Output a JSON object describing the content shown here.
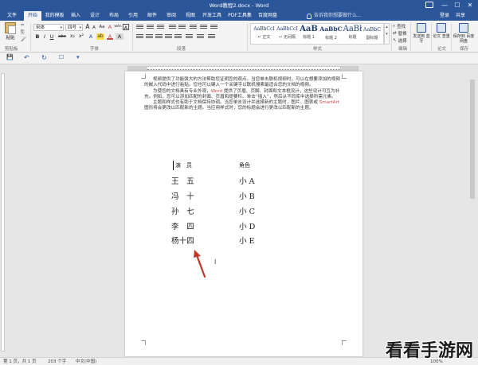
{
  "app": {
    "title": "Word教程2.docx - Word",
    "window_buttons": [
      "—",
      "☐",
      "✕"
    ]
  },
  "tabs": [
    {
      "label": "文件",
      "active": false
    },
    {
      "label": "开始",
      "active": true
    },
    {
      "label": "我的模板",
      "active": false
    },
    {
      "label": "插入",
      "active": false
    },
    {
      "label": "设计",
      "active": false
    },
    {
      "label": "布局",
      "active": false
    },
    {
      "label": "引用",
      "active": false
    },
    {
      "label": "邮件",
      "active": false
    },
    {
      "label": "审阅",
      "active": false
    },
    {
      "label": "视图",
      "active": false
    },
    {
      "label": "开发工具",
      "active": false
    },
    {
      "label": "PDF工具集",
      "active": false
    },
    {
      "label": "百度网盘",
      "active": false
    }
  ],
  "tell_me": "告诉我你想要做什么...",
  "account": {
    "login": "登录",
    "share": "共享"
  },
  "ribbon": {
    "clipboard": {
      "paste": "粘贴",
      "group": "剪贴板",
      "cut": "✂",
      "copy": "⎘",
      "format_painter": "🖌"
    },
    "font": {
      "group": "字体",
      "font_name": "宋体",
      "font_size": "四号",
      "bold": "B",
      "italic": "I",
      "underline": "U",
      "strike": "abc",
      "subscript": "x₂",
      "superscript": "x²",
      "font_color": "A",
      "highlight": "ab",
      "grow": "A",
      "shrink": "A",
      "change_case": "Aa",
      "clear": "A",
      "phonetic": "wén",
      "border": "A"
    },
    "paragraph": {
      "group": "段落"
    },
    "styles": {
      "group": "样式",
      "items": [
        {
          "sample": "AaBbCcI",
          "name": "↵ 正文"
        },
        {
          "sample": "AaBbCcI",
          "name": "↵ 无间隔"
        },
        {
          "sample": "AaB",
          "name": "标题 1"
        },
        {
          "sample": "AaBbC",
          "name": "标题 2"
        },
        {
          "sample": "AaBł",
          "name": "标题"
        },
        {
          "sample": "AaBbC",
          "name": "副标题"
        }
      ]
    },
    "editing": {
      "group": "编辑",
      "find": "查找",
      "replace": "替换",
      "select": "选择"
    },
    "extras": [
      {
        "label": "发送到\n蓝牙"
      },
      {
        "label": "论文\n查重"
      },
      {
        "label": "保存到\n百度网盘"
      }
    ],
    "extras_groups": [
      "论文",
      "保存"
    ]
  },
  "qat": {
    "save": "💾",
    "undo": "↶",
    "redo": "↻",
    "touch": "☐",
    "customize": "▾"
  },
  "document": {
    "paragraphs": [
      {
        "parts": [
          "视频提供了功能强大的方法帮助您证明您的观点。当您单击联机视频时，可以在想要添加的视频的嵌入代码中进行粘贴。您也可以键入一个关键字以联机搜索最适合您的文档的视频。"
        ]
      },
      {
        "parts": [
          "为使您的文档具有专业外观，",
          "Word",
          " 提供了页眉、页脚、封面和文本框设计，这些设计可互为补充。例如，您可以添加匹配的封面、页眉和提要栏。单击“插入”，然后从不同库中选择所需元素。"
        ]
      },
      {
        "parts": [
          "主题和样式也有助于文档保持协调。当您单击设计并选择新的主题时，图片、图表或 ",
          "SmartArt",
          " 图形将会更改以匹配新的主题。当应用样式时，您的标题会进行更改以匹配新的主题。"
        ]
      }
    ],
    "roster": {
      "header": [
        "演　员",
        "角色"
      ],
      "rows": [
        [
          "王　五",
          "小 A"
        ],
        [
          "冯　十",
          "小 B"
        ],
        [
          "孙　七",
          "小 C"
        ],
        [
          "李　四",
          "小 D"
        ],
        [
          "杨十四",
          "小 E"
        ]
      ]
    }
  },
  "status": {
    "page": "第 1 页，共 1 页",
    "words": "203 个字",
    "language": "中文(中国)",
    "zoom": "100%"
  },
  "watermark": "看看手游网",
  "colors": {
    "accent": "#2b579a",
    "annotation_arrow": "#c0392b"
  }
}
